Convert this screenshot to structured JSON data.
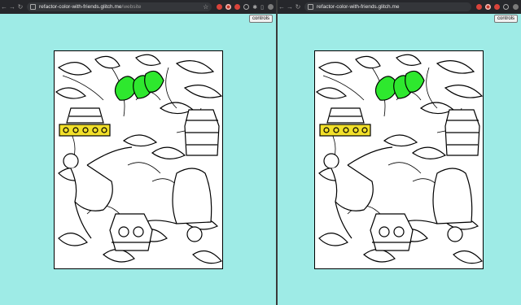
{
  "browser": {
    "url_host": "refactor-color-with-friends.glitch.me",
    "url_path": "/website"
  },
  "left_window": {
    "url_host": "refactor-color-with-friends.glitch.me",
    "url_path": "/website",
    "controls_label": "controls"
  },
  "right_window": {
    "url_host": "refactor-color-with-friends.glitch.me",
    "url_path": "",
    "controls_label": "controls"
  },
  "colors": {
    "background": "#9eebe6",
    "toolbar": "#26272b",
    "leaf_fill": "#2ee82e",
    "vase_band_fill": "#f2e02a",
    "line_art": "#000000"
  },
  "icons": [
    "back-icon",
    "forward-icon",
    "reload-icon",
    "lock-icon",
    "bookmark-star-icon",
    "extension-icon",
    "profile-avatar-icon"
  ]
}
